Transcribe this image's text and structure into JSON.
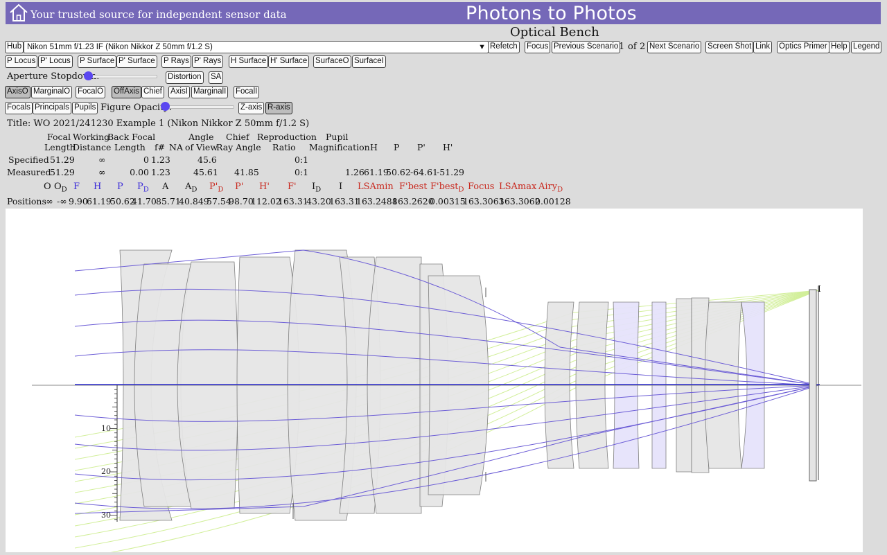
{
  "header": {
    "tagline": "Your trusted source for independent sensor data",
    "brand": "Photons to Photos",
    "subtitle": "Optical Bench",
    "home_icon": "home-icon"
  },
  "toolbar": {
    "hub": "Hub",
    "lens_select": "Nikon 51mm f/1.23 IF (Nikon Nikkor Z 50mm f/1.2 S)",
    "refetch": "Refetch",
    "focus": "Focus",
    "previous_scenario": "Previous Scenario",
    "scenario_current": "1",
    "of": "of",
    "scenario_total": "2",
    "next_scenario": "Next Scenario",
    "screen_shot": "Screen Shot",
    "link": "Link",
    "optics_primer": "Optics Primer",
    "help": "Help",
    "legend": "Legend"
  },
  "row2": {
    "p_locus": "P Locus",
    "pp_locus": "P' Locus",
    "p_surface": "P Surface",
    "pp_surface": "P' Surface",
    "p_rays": "P Rays",
    "pp_rays": "P' Rays",
    "h_surface": "H Surface",
    "hp_surface": "H' Surface",
    "surfaceo": "SurfaceO",
    "surfacei": "SurfaceI"
  },
  "row3": {
    "aperture_label": "Aperture Stopdown:",
    "aperture_value": 0,
    "distortion": "Distortion",
    "sa": "SA"
  },
  "row4": {
    "axiso": "AxisO",
    "marginalo": "MarginalO",
    "focalo": "FocalO",
    "offaxis": "OffAxis",
    "chief": "Chief",
    "axisi": "AxisI",
    "marginali": "MarginalI",
    "focali": "FocalI"
  },
  "row5": {
    "focals": "Focals",
    "principals": "Principals",
    "pupils": "Pupils",
    "opacity_label": "Figure Opacity:",
    "opacity_value": 0,
    "zaxis": "Z-axis",
    "raxis": "R-axis"
  },
  "specs": {
    "title": "Title: WO 2021/241230 Example 1 (Nikon Nikkor Z 50mm f/1.2 S)",
    "headers": {
      "focal_1": "Focal",
      "focal_2": "Length",
      "working_1": "Working",
      "working_2": "Distance",
      "back_1": "Back Focal",
      "back_2": "Length",
      "fnum": "f#",
      "na": "NA",
      "angle_1": "Angle",
      "angle_2": "of View",
      "chief_1": "Chief",
      "chief_2": "Ray Angle",
      "repro_1": "Reproduction",
      "repro_2": "Ratio",
      "pupil_1": "Pupil",
      "pupil_2": "Magnification",
      "h": "H",
      "p": "P",
      "pp": "P'",
      "hp": "H'"
    },
    "specified": {
      "label": "Specified",
      "focal": "51.29",
      "working": "∞",
      "back": "0",
      "fnum": "1.23",
      "angle": "45.6",
      "chief": "",
      "repro": "0:1",
      "pupil": "",
      "h": "",
      "p": "",
      "pp": "",
      "hp": ""
    },
    "measured": {
      "label": "Measured",
      "focal": "51.29",
      "working": "∞",
      "back": "0.00",
      "fnum": "1.23",
      "angle": "45.61",
      "chief": "41.85",
      "repro": "0:1",
      "pupil": "1.26",
      "h": "61.19",
      "p": "50.62",
      "pp": "-64.61",
      "hp": "-51.29"
    }
  },
  "positions": {
    "symbols": {
      "o": "O",
      "od_main": "O",
      "od_sub": "D",
      "f": "F",
      "h": "H",
      "p": "P",
      "pd_main": "P",
      "pd_sub": "D",
      "a": "A",
      "ad_main": "A",
      "ad_sub": "D",
      "ppd_main": "P'",
      "ppd_sub": "D",
      "pp": "P'",
      "hp": "H'",
      "fp": "F'",
      "id_main": "I",
      "id_sub": "D",
      "i": "I",
      "lsamin": "LSAmin",
      "fbest": "F'best",
      "fbestd_main": "F'best",
      "fbestd_sub": "D",
      "focus": "Focus",
      "lsamax": "LSAmax",
      "airyd_main": "Airy",
      "airyd_sub": "D"
    },
    "label": "Positions",
    "values": {
      "o": "-∞",
      "od": "-∞",
      "f": "9.90",
      "h": "61.19",
      "p": "50.62",
      "pd": "41.70",
      "a": "85.71",
      "ad": "40.849",
      "ppd": "57.54",
      "pp": "98.70",
      "hp": "112.02",
      "fp": "163.31",
      "id": "43.20",
      "i": "163.31",
      "lsamin": "163.2488",
      "fbest": "163.2620",
      "fbestd": "0.00315",
      "focus": "163.3063",
      "lsamax": "163.3062",
      "airyd": "0.00128"
    }
  },
  "diagram": {
    "axis_ticks": [
      "10",
      "20",
      "30"
    ],
    "image_label": "I",
    "colors": {
      "lens": "#e6e6e6",
      "lens_edge": "#7a7a7a",
      "lens_alt": "#e6e3fb",
      "ray_axial": "#6b5cd6",
      "ray_offaxis": "#d2ef9a",
      "axis": "#3b3b3b"
    }
  }
}
